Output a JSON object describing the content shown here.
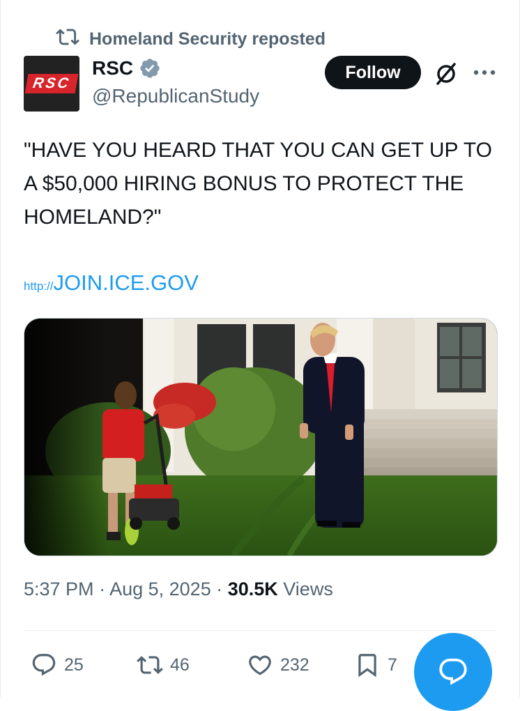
{
  "repost": {
    "text": "Homeland Security reposted"
  },
  "author": {
    "avatar_text": "RSC",
    "name": "RSC",
    "handle": "@RepublicanStudy",
    "verified": true
  },
  "header_actions": {
    "follow_label": "Follow",
    "grok_icon": "grok-icon",
    "more_icon": "more-icon"
  },
  "tweet": {
    "text": "\"HAVE YOU HEARD THAT YOU CAN GET UP TO A $50,000 HIRING BONUS TO PROTECT THE HOMELAND?\"",
    "link_prefix": "http://",
    "link_domain": "JOIN.ICE.GOV"
  },
  "meta": {
    "time": "5:37 PM",
    "sep1": " · ",
    "date": "Aug 5, 2025",
    "sep2": " · ",
    "views": "30.5K",
    "views_label": " Views"
  },
  "actions": {
    "replies": "25",
    "reposts": "46",
    "likes": "232",
    "bookmarks": "7"
  },
  "colors": {
    "accent": "#1d9bf0",
    "text": "#0f1419",
    "secondary": "#536471",
    "rsc_red": "#d8242b"
  }
}
